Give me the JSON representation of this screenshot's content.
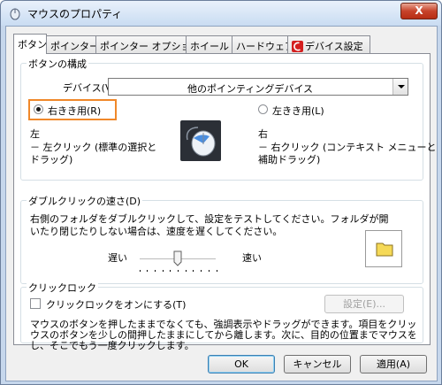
{
  "window": {
    "title": "マウスのプロパティ",
    "close_label": "X"
  },
  "tabs": [
    {
      "label": "ボタン"
    },
    {
      "label": "ポインター"
    },
    {
      "label": "ポインター オプション"
    },
    {
      "label": "ホイール"
    },
    {
      "label": "ハードウェア"
    },
    {
      "label": "デバイス設定"
    }
  ],
  "button_config": {
    "group_label": "ボタンの構成",
    "device_label": "デバイス(V):",
    "device_value": "他のポインティングデバイス",
    "right_handed_label": "右きき用(R)",
    "left_handed_label": "左きき用(L)",
    "left_title": "左",
    "left_desc_1": "－ 左クリック (標準の選択と",
    "left_desc_2": "ドラッグ)",
    "right_title": "右",
    "right_desc_1": "－ 右クリック (コンテキスト メニューと",
    "right_desc_2": "補助ドラッグ)"
  },
  "double_click": {
    "group_label": "ダブルクリックの速さ(D)",
    "desc_1": "右側のフォルダをダブルクリックして、設定をテストしてください。フォルダが開",
    "desc_2": "いたり閉じたりしない場合は、速度を遅くしてください。",
    "slow_label": "遅い",
    "fast_label": "速い",
    "speed": 0.5
  },
  "click_lock": {
    "group_label": "クリックロック",
    "checkbox_label": "クリックロックをオンにする(T)",
    "settings_button": "設定(E)...",
    "desc_1": "マウスのボタンを押したままでなくても、強調表示やドラッグができます。項目をクリックし、マ",
    "desc_2": "ウスのボタンを少しの間押したままにしてから離します。次に、目的の位置までマウスを移動",
    "desc_3": "し、そこでもう一度クリックします。"
  },
  "footer": {
    "ok": "OK",
    "cancel": "キャンセル",
    "apply": "適用(A)"
  },
  "icons": [
    "mouse-app-icon",
    "mouse-icon",
    "folder-icon",
    "device-settings-icon",
    "close-icon"
  ],
  "colors": {
    "highlight": "#f0882a",
    "title_bg": "#c9dcf2",
    "folder": "#f5d957"
  }
}
